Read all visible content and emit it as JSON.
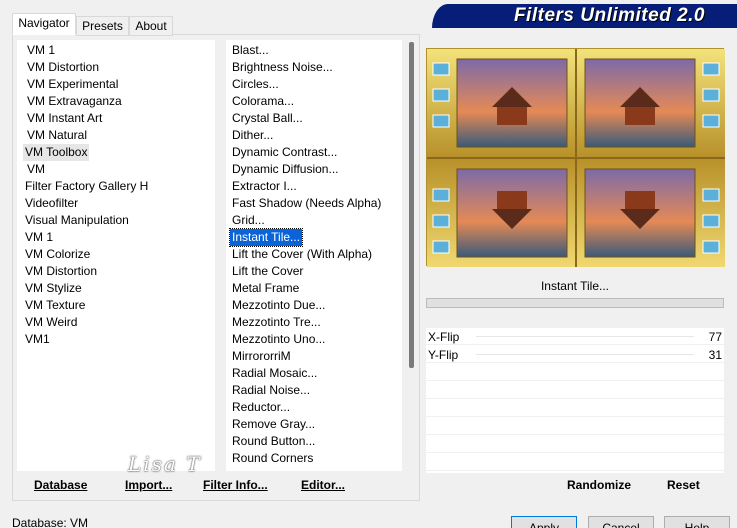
{
  "tabs": [
    {
      "label": "Navigator"
    },
    {
      "label": "Presets"
    },
    {
      "label": "About"
    }
  ],
  "brand": {
    "title": "Filters Unlimited 2.0"
  },
  "categories": [
    "VM 1",
    "VM Distortion",
    "VM Experimental",
    "VM Extravaganza",
    "VM Instant Art",
    "VM Natural",
    "VM Toolbox",
    "VM",
    "Filter Factory Gallery H",
    "Videofilter",
    "Visual Manipulation",
    "VM 1",
    "VM Colorize",
    "VM Distortion",
    "VM Stylize",
    "VM Texture",
    "VM Weird",
    "VM1"
  ],
  "filters": [
    "Blast...",
    "Brightness Noise...",
    "Circles...",
    "Colorama...",
    "Crystal Ball...",
    "Dither...",
    "Dynamic Contrast...",
    "Dynamic Diffusion...",
    "Extractor I...",
    "Fast Shadow (Needs Alpha)",
    "Grid...",
    "Instant Tile...",
    "Lift the Cover (With Alpha)",
    "Lift the Cover",
    "Metal Frame",
    "Mezzotinto Due...",
    "Mezzotinto Tre...",
    "Mezzotinto Uno...",
    "MirrororriM",
    "Radial Mosaic...",
    "Radial Noise...",
    "Reductor...",
    "Remove Gray...",
    "Round Button...",
    "Round Corners"
  ],
  "bottom_buttons": {
    "database": "Database",
    "import": "Import...",
    "filter_info": "Filter Info...",
    "editor": "Editor..."
  },
  "watermark": "Lisa T",
  "current_filter": "Instant Tile...",
  "params": [
    {
      "label": "X-Flip",
      "value": "77"
    },
    {
      "label": "Y-Flip",
      "value": "31"
    }
  ],
  "right_buttons": {
    "randomize": "Randomize",
    "reset": "Reset"
  },
  "status": {
    "text": "Database:  VM"
  },
  "dialog_buttons": {
    "apply": "Apply",
    "cancel": "Cancel",
    "help": "Help"
  },
  "colors": {
    "brand": "#071e78",
    "selection": "#0a64d8"
  }
}
